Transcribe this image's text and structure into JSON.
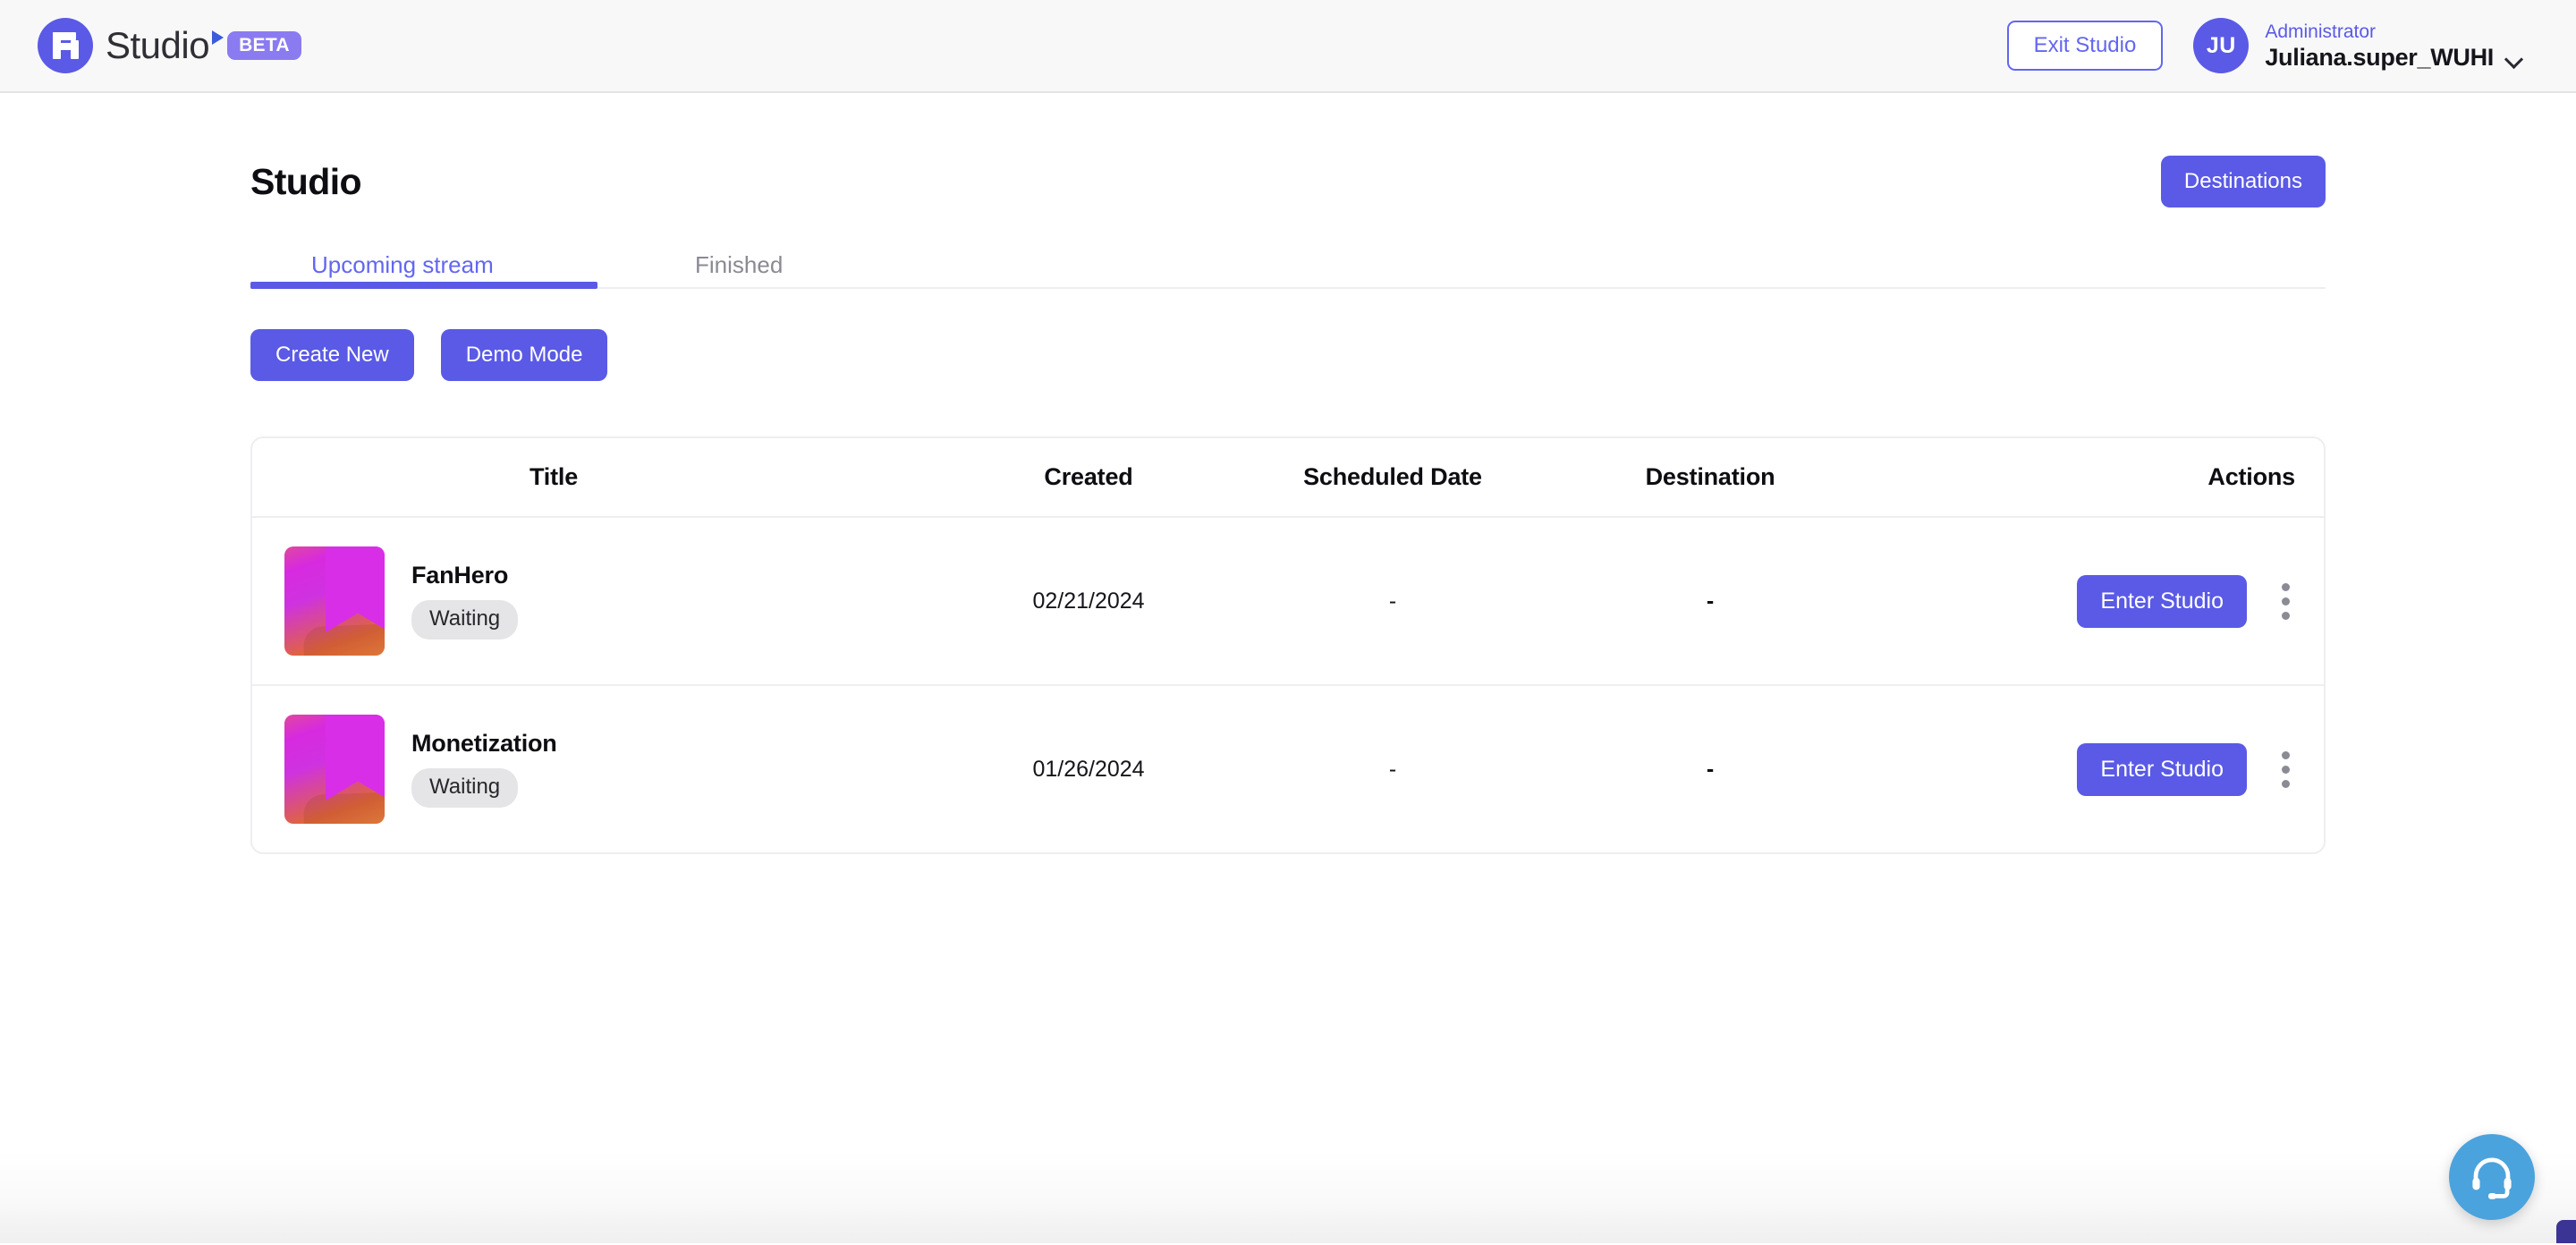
{
  "topbar": {
    "brand_word": "Studio",
    "brand_badge": "BETA",
    "exit_label": "Exit Studio",
    "avatar_initials": "JU",
    "user_role": "Administrator",
    "user_name": "Juliana.super_WUHI",
    "brand_color": "#5a5ae6",
    "badge_color": "#8b7bf0"
  },
  "header": {
    "page_title": "Studio",
    "destinations_label": "Destinations"
  },
  "tabs": [
    {
      "label": "Upcoming stream",
      "active": true
    },
    {
      "label": "Finished",
      "active": false
    }
  ],
  "toolbar": {
    "create_new_label": "Create New",
    "demo_mode_label": "Demo Mode"
  },
  "table": {
    "columns": [
      "Title",
      "Created",
      "Scheduled Date",
      "Destination",
      "Actions"
    ],
    "rows": [
      {
        "title": "FanHero",
        "status": "Waiting",
        "created": "02/21/2024",
        "scheduled_date": "-",
        "destination": "-",
        "action_label": "Enter Studio"
      },
      {
        "title": "Monetization",
        "status": "Waiting",
        "created": "01/26/2024",
        "scheduled_date": "-",
        "destination": "-",
        "action_label": "Enter Studio"
      }
    ]
  },
  "support": {
    "icon": "headset-icon",
    "color": "#4ba3dd"
  }
}
